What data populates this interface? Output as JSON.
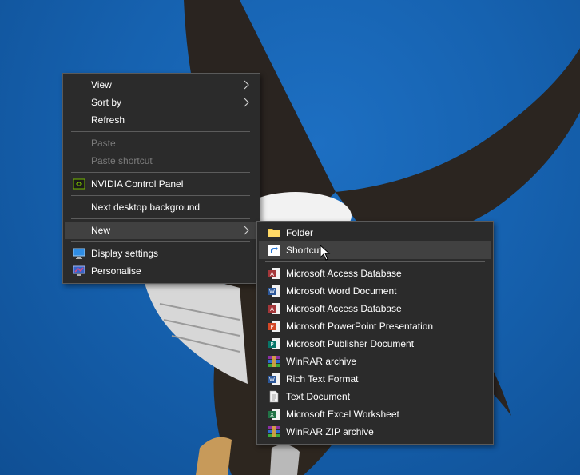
{
  "context_menu": {
    "view_label": "View",
    "sortby_label": "Sort by",
    "refresh_label": "Refresh",
    "paste_label": "Paste",
    "paste_shortcut_label": "Paste shortcut",
    "nvidia_label": "NVIDIA Control Panel",
    "next_bg_label": "Next desktop background",
    "new_label": "New",
    "display_settings_label": "Display settings",
    "personalise_label": "Personalise"
  },
  "new_submenu": {
    "folder_label": "Folder",
    "shortcut_label": "Shortcut",
    "access1_label": "Microsoft Access Database",
    "word_label": "Microsoft Word Document",
    "access2_label": "Microsoft Access Database",
    "powerpoint_label": "Microsoft PowerPoint Presentation",
    "publisher_label": "Microsoft Publisher Document",
    "winrar_label": "WinRAR archive",
    "rtf_label": "Rich Text Format",
    "text_label": "Text Document",
    "excel_label": "Microsoft Excel Worksheet",
    "winrar_zip_label": "WinRAR ZIP archive"
  },
  "colors": {
    "menu_bg": "#2b2b2b",
    "menu_hover": "#414141",
    "disabled_text": "#7b7b7b",
    "desktop_blue": "#1662b0"
  }
}
